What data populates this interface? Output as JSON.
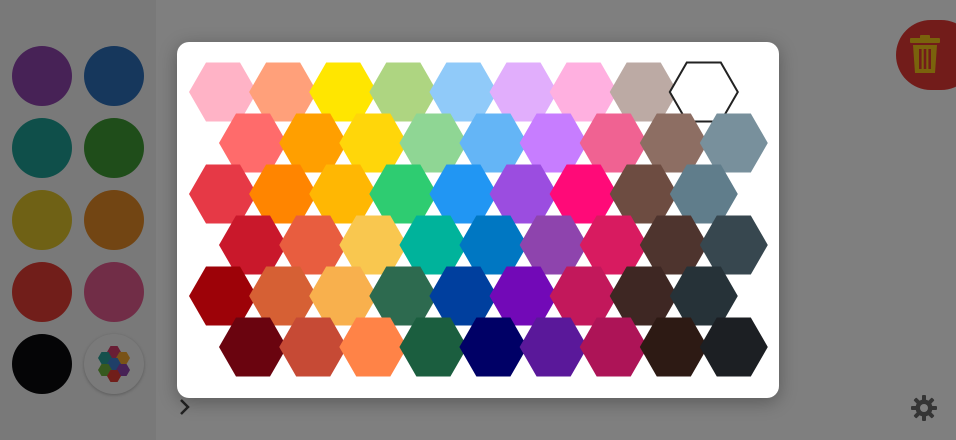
{
  "sidebar": {
    "swatches": [
      {
        "name": "swatch-purple",
        "color": "#8e44ad"
      },
      {
        "name": "swatch-blue",
        "color": "#2d6fb8"
      },
      {
        "name": "swatch-teal",
        "color": "#1f9e95"
      },
      {
        "name": "swatch-green",
        "color": "#3f9a35"
      },
      {
        "name": "swatch-yellow",
        "color": "#dfc32a"
      },
      {
        "name": "swatch-orange",
        "color": "#e58a26"
      },
      {
        "name": "swatch-red",
        "color": "#e23c35"
      },
      {
        "name": "swatch-pink",
        "color": "#e25a8e"
      },
      {
        "name": "swatch-black",
        "color": "#0a0a0c"
      }
    ],
    "multi_swatch": {
      "name": "multi-color-swatch",
      "colors": [
        "#d23c6a",
        "#3f7fd0",
        "#2aa198",
        "#f2a630",
        "#6fb23f",
        "#8e44ad",
        "#e23c35"
      ]
    }
  },
  "overlay_color": "rgba(0,0,0,0.5)",
  "trash_button": {
    "icon": "trash-icon",
    "color": "#e53935",
    "icon_color": "#f5c518"
  },
  "settings_button": {
    "icon": "gear-icon"
  },
  "chevron": {
    "icon": "chevron-right-icon"
  },
  "picker": {
    "selected": "#ffffff",
    "rows": [
      [
        "#ffb3c6",
        "#ffa07a",
        "#ffe600",
        "#aed581",
        "#90caf9",
        "#e1aefc",
        "#ffb0e0",
        "#bcaaa4",
        "#ffffff"
      ],
      [
        "#ff6b6b",
        "#ff9f00",
        "#ffd60a",
        "#8fd694",
        "#64b5f6",
        "#c77dff",
        "#f06292",
        "#8d6e63",
        "#78909c"
      ],
      [
        "#e63946",
        "#ff8500",
        "#ffb703",
        "#2ecc71",
        "#2196f3",
        "#9b4de0",
        "#ff0a78",
        "#6d4c41",
        "#607d8b"
      ],
      [
        "#c9182b",
        "#e85d3f",
        "#f9c74f",
        "#00b39b",
        "#0077c2",
        "#8e44ad",
        "#d81b60",
        "#4e342e",
        "#37474f"
      ],
      [
        "#9d0208",
        "#d66034",
        "#f8b04d",
        "#2d6a4f",
        "#003f9e",
        "#7209b7",
        "#c2185b",
        "#3e2723",
        "#263238"
      ],
      [
        "#6a040f",
        "#c64a35",
        "#ff8347",
        "#1b5e3f",
        "#000066",
        "#5a189a",
        "#ad1457",
        "#2d1a14",
        "#1c1f23"
      ]
    ]
  }
}
